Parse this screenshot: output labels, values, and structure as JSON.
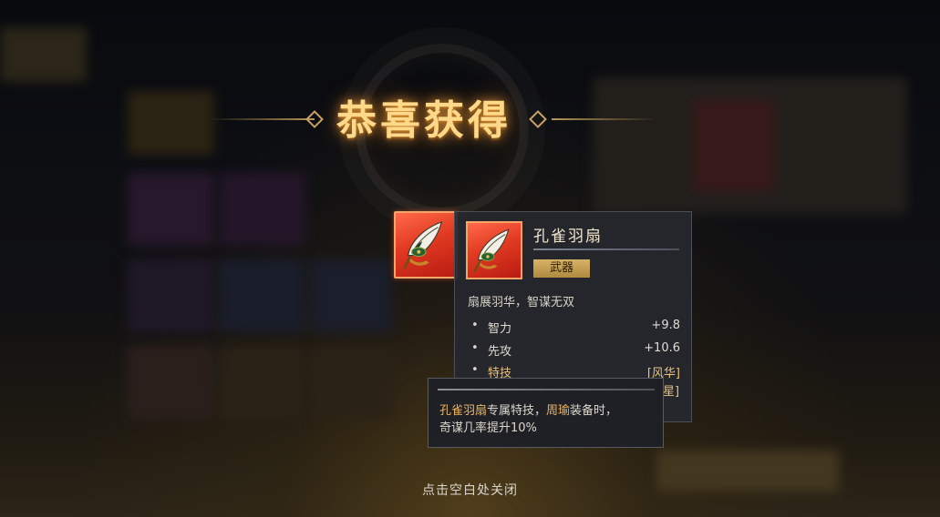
{
  "title": "恭喜获得",
  "item": {
    "name": "孔雀羽扇",
    "type_label": "武器",
    "description": "扇展羽华，智谋无双",
    "icon": "peacock-fan-icon",
    "stats": [
      {
        "label": "智力",
        "value": "+9.8"
      },
      {
        "label": "先攻",
        "value": "+10.6"
      },
      {
        "label": "特技",
        "value": "[风华]"
      }
    ],
    "peek_text": "星]"
  },
  "skill_popup": {
    "line1": {
      "part1": "孔雀羽扇",
      "part2": "专属特技，",
      "part3": "周瑜",
      "part4": "装备时，"
    },
    "line2": "奇谋几率提升10%"
  },
  "close_hint": "点击空白处关闭",
  "colors": {
    "accent_gold": "#e9c17a",
    "rarity_red": "#e23a22",
    "title_gold": "#ffd98a"
  }
}
